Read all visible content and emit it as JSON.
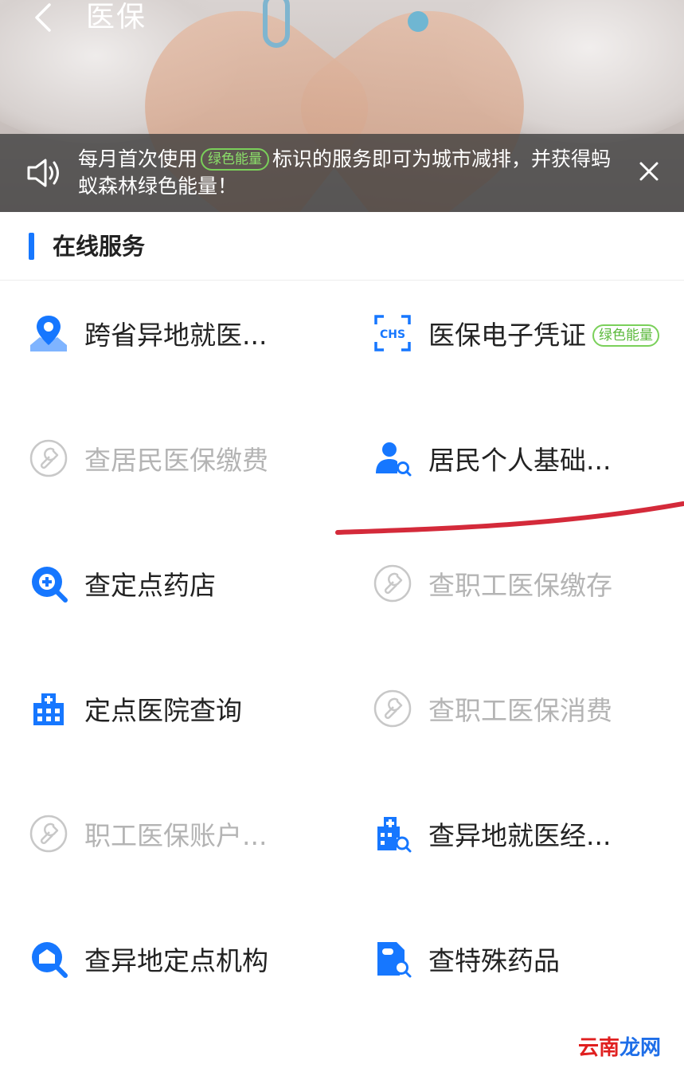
{
  "header": {
    "title": "医保"
  },
  "notice": {
    "text_before": "每月首次使用",
    "tag": "绿色能量",
    "text_after": "标识的服务即可为城市减排，并获得蚂蚁森林绿色能量！"
  },
  "section": {
    "title": "在线服务"
  },
  "services": [
    {
      "label": "跨省异地就医...",
      "icon": "map-pin-icon",
      "enabled": true
    },
    {
      "label": "医保电子凭证",
      "icon": "chs-scan-icon",
      "enabled": true,
      "tag": "绿色能量"
    },
    {
      "label": "查居民医保缴费",
      "icon": "wrench-icon",
      "enabled": false
    },
    {
      "label": "居民个人基础...",
      "icon": "user-search-icon",
      "enabled": true
    },
    {
      "label": "查定点药店",
      "icon": "pharmacy-search-icon",
      "enabled": true
    },
    {
      "label": "查职工医保缴存",
      "icon": "wrench-icon",
      "enabled": false
    },
    {
      "label": "定点医院查询",
      "icon": "hospital-icon",
      "enabled": true
    },
    {
      "label": "查职工医保消费",
      "icon": "wrench-icon",
      "enabled": false
    },
    {
      "label": "职工医保账户...",
      "icon": "wrench-icon",
      "enabled": false
    },
    {
      "label": "查异地就医经...",
      "icon": "hospital-search-icon",
      "enabled": true
    },
    {
      "label": "查异地定点机构",
      "icon": "institution-search-icon",
      "enabled": true
    },
    {
      "label": "查特殊药品",
      "icon": "medicine-search-icon",
      "enabled": true
    }
  ],
  "watermark": {
    "part1": "云南",
    "part2": "龙网"
  },
  "colors": {
    "accent": "#1677ff",
    "disabled": "#b4b4b4",
    "green": "#7ad05a",
    "annotation": "#d42a3a"
  }
}
